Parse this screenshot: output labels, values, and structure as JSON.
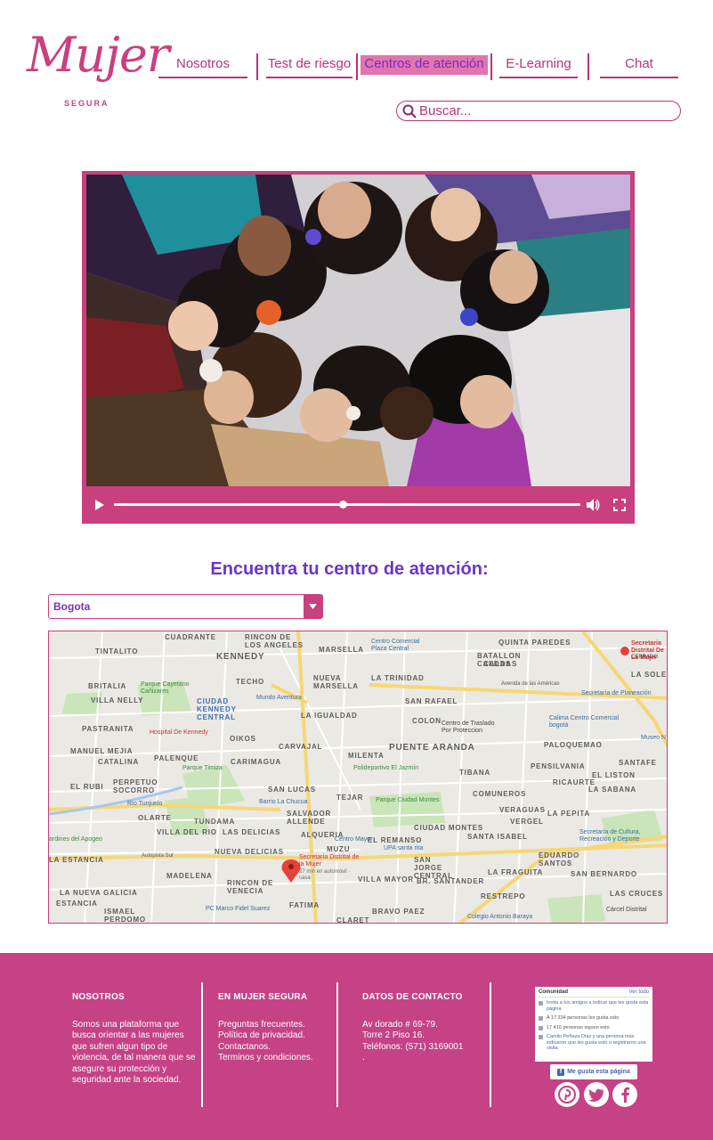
{
  "logo": {
    "word": "Mujer",
    "sub": "SEGURA"
  },
  "nav": {
    "items": [
      {
        "label": "Nosotros",
        "active": false
      },
      {
        "label": "Test de riesgo",
        "active": false
      },
      {
        "label": "Centros de atención",
        "active": true
      },
      {
        "label": "E-Learning",
        "active": false
      },
      {
        "label": "Chat",
        "active": false
      }
    ]
  },
  "search": {
    "placeholder": "Buscar..."
  },
  "video": {
    "progress": 0.49
  },
  "finder": {
    "title": "Encuentra tu centro de atención:",
    "city": "Bogota"
  },
  "map": {
    "neighborhoods": [
      "CUADRANTE",
      "RINCON DE LOS ANGELES",
      "TINTALITO",
      "KENNEDY",
      "MARSELLA",
      "BATALLON CALDAS",
      "QUINTA PAREDES",
      "TECHO",
      "NUEVA MARSELLA",
      "LA TRINIDAD",
      "BRITALIA",
      "VILLA NELLY",
      "CIUDAD KENNEDY CENTRAL",
      "LA IGUALDAD",
      "SAN RAFAEL",
      "COLON",
      "PASTRANITA",
      "OIKOS",
      "MANUEL MEJIA",
      "CATALINA",
      "PALENQUE",
      "CARVAJAL",
      "MILENTA",
      "PUENTE ARANDA",
      "PALOQUEMAO",
      "CARIMAGUA",
      "TIBANA",
      "PENSILVANIA",
      "SANTAFE",
      "EL RUBI",
      "PERPETUO SOCORRO",
      "SAN LUCAS",
      "COMUNEROS",
      "RICAURTE",
      "EL LISTON",
      "LA SABANA",
      "OLARTE",
      "TEJAR",
      "VERAGUAS",
      "LA PEPITA",
      "TUNDAMA",
      "SALVADOR ALLENDE",
      "VILLA DEL RIO",
      "LAS DELICIAS",
      "ALQUERIA",
      "CIUDAD MONTES",
      "SANTA ISABEL",
      "VERGEL",
      "LA ESTANCIA",
      "NUEVA DELICIAS",
      "MUZU",
      "EL REMANSO",
      "SAN JORGE CENTRAL",
      "LA FRAGUITA",
      "EDUARDO SANTOS",
      "MADELENA",
      "RINCON DE VENECIA",
      "VILLA MAYOR",
      "BR. SANTANDER",
      "SAN BERNARDO",
      "LA NUEVA GALICIA",
      "ESTANCIA",
      "FATIMA",
      "RESTREPO",
      "LAS CRUCES",
      "ISMAEL PERDOMO",
      "BRAVO PAEZ",
      "CLARET",
      "LA SOLEDAD",
      "CALDAS"
    ],
    "pois": {
      "main_marker": "Secretaría Distrital de la Mujer",
      "main_sub": "27 min en automóvil · casa",
      "top_right": "Secretaria Distrital De La Mujer",
      "top_right_sub": "CERRADO",
      "planeacion": "Secretaría de Planeación",
      "calima": "Calima Centro Comercial bogotá",
      "museo": "Museo N",
      "traslado": "Centro de Traslado Por Proteccion",
      "plaza": "Centro Comercial Plaza Central",
      "cayetano": "Parque Cayetano Cañizares",
      "aventura": "Mundo Aventura",
      "hospital": "Hospital De Kennedy",
      "timiza": "Parque Timiza",
      "polideportivo": "Polideportivo El Jazmín",
      "porvenir": "Río Tunjuelo",
      "chucua": "Barrio La Chucua",
      "montes": "Parque Ciudad Montes",
      "upa": "UPA santa rita",
      "centromayor": "Centro Mayor",
      "cultura": "Secretaría de Cultura, Recreación y Deporte",
      "carcel": "Cárcel Distrital",
      "fidel": "PC Marco Fidel Suarez",
      "baraya": "Colegio Antonio Baraya",
      "apogeo": "ardines del Apogeo",
      "autopista": "Autopista Sur",
      "americas": "Avenida de las Américas"
    }
  },
  "footer": {
    "nosotros": {
      "title": "NOSOTROS",
      "text": "Somos una plataforma que busca orientar a las mujeres que sufren algun tipo de violencia, de tal manera que se asegure su protección y seguridad ante la sociedad."
    },
    "links": {
      "title": "EN MUJER SEGURA",
      "items": [
        "Preguntas frecuentes.",
        "Política de privacidad.",
        "Contactanos.",
        "Terminos y condiciones."
      ]
    },
    "contact": {
      "title": "DATOS DE CONTACTO",
      "lines": [
        "Av dorado # 69-79.",
        "Torre 2 Piso 16.",
        "Teléfonos: (571) 3169001",
        "."
      ]
    },
    "facebook": {
      "box_title": "Comunidad",
      "box_link": "Ver todo",
      "rows": [
        "Invita a tus amigos a indicar que les gusta esta página",
        "A 17 334 personas les gusta esto",
        "17 410 personas siguen esto",
        "Camilo Peñaza Díaz y una persona más indicaron que les gusta esto o registraron una visita"
      ],
      "like_label": "Me gusta esta página"
    },
    "social": [
      "pinterest-icon",
      "twitter-icon",
      "facebook-icon"
    ]
  }
}
